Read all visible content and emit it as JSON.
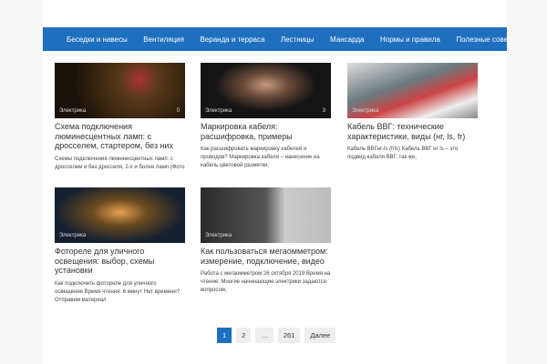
{
  "nav": [
    "Беседки и навесы",
    "Вентиляция",
    "Веранда и терраса",
    "Лестницы",
    "Мансарда",
    "Нормы и правила",
    "Полезные советы"
  ],
  "posts": [
    {
      "category": "Электрика",
      "comments": "0",
      "title": "Схема подключения люминесцентных ламп: с дросселем, стартером, без них",
      "excerpt": "Схемы подключения люминесцентных ламп: с дросселем и без дросселя, 2-х и более ламп (Фото"
    },
    {
      "category": "Электрика",
      "comments": "3",
      "title": "Маркировка кабеля: расшифровка, примеры",
      "excerpt": "Как расшифровать маркировку кабелей и проводов? Маркировка кабеля – нанесение на кабель цветовой разметки,"
    },
    {
      "category": "Электрика",
      "comments": "",
      "title": "Кабель ВВГ: технические характеристики, виды (нг, ls, fr)",
      "excerpt": "Кабель ВВГнг-ls (frls) Кабель ВВГ нг ls – это подвид кабеля ВВГ, так же,"
    },
    {
      "category": "Электрика",
      "comments": "",
      "title": "Фотореле для уличного освещения: выбор, схемы установки",
      "excerpt": "Как подключить фотореле для уличного освещения Время чтения: 6 минут Нет времени? Отправим материал"
    },
    {
      "category": "Электрика",
      "comments": "",
      "title": "Как пользоваться мегаомметром: измерение, подключение, видео",
      "excerpt": "Работа с мегаомметром 26 октября 2019 Время на чтение: Многие начинающие электрики задаются вопросом,"
    }
  ],
  "pagination": {
    "current": "1",
    "pages": [
      "2",
      "…",
      "261"
    ],
    "next": "Далее"
  },
  "colors": {
    "accent": "#1f6fbf"
  }
}
